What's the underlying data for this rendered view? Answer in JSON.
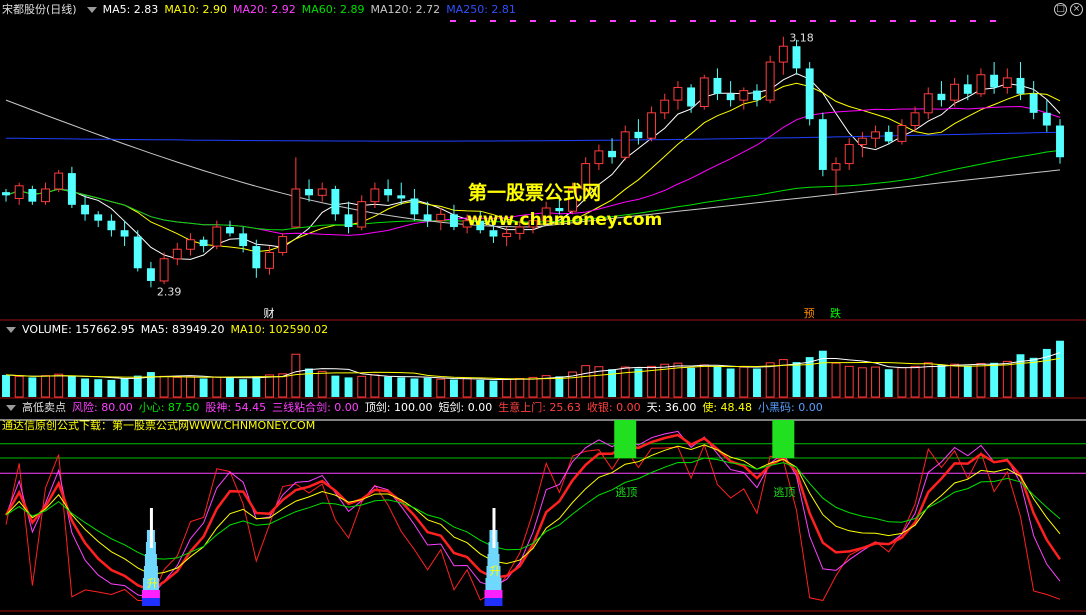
{
  "colors": {
    "up": "#ff3c3c",
    "down": "#54ffff",
    "bg": "#000000",
    "ma5": "#ffffff",
    "ma10": "#ffff00",
    "ma20": "#ff00ff",
    "ma60": "#00e000",
    "ma120": "#c8c8c8",
    "ma250": "#2040ff"
  },
  "header": {
    "title": "宋都股份(日线)",
    "ma": [
      {
        "label": "MA5: 2.83",
        "color": "#ffffff"
      },
      {
        "label": "MA10: 2.90",
        "color": "#ffff00"
      },
      {
        "label": "MA20: 2.92",
        "color": "#ff40ff"
      },
      {
        "label": "MA60: 2.89",
        "color": "#00e000"
      },
      {
        "label": "MA120: 2.72",
        "color": "#c8c8c8"
      },
      {
        "label": "MA250: 2.81",
        "color": "#3050ff"
      }
    ]
  },
  "watermark": {
    "line1": "第一股票公式网",
    "line2": "www.chnmoney.com"
  },
  "price_panel": {
    "high_label": "3.18",
    "low_label": "2.39",
    "markers": [
      {
        "text": "财",
        "color": "#ffffff",
        "idx": 20
      },
      {
        "text": "预",
        "color": "#ff8c00",
        "idx": 61
      },
      {
        "text": "跌",
        "color": "#00ff00",
        "idx": 63
      }
    ]
  },
  "volume_panel": {
    "items": [
      {
        "label": "VOLUME: 157662.95",
        "color": "#ffffff"
      },
      {
        "label": "MA5: 83949.20",
        "color": "#ffffff"
      },
      {
        "label": "MA10: 102590.02",
        "color": "#ffff00"
      }
    ]
  },
  "indicator_panel": {
    "name": "高低卖点",
    "items": [
      {
        "label": "风险: 80.00",
        "color": "#ff40ff"
      },
      {
        "label": "小心: 87.50",
        "color": "#00e000"
      },
      {
        "label": "股神: 54.45",
        "color": "#ff40ff"
      },
      {
        "label": "三线粘合剑: 0.00",
        "color": "#ff40ff"
      },
      {
        "label": "顶剑: 100.00",
        "color": "#ffffff"
      },
      {
        "label": "短剑: 0.00",
        "color": "#ffffff"
      },
      {
        "label": "生意上门: 25.63",
        "color": "#ff4040"
      },
      {
        "label": "收银: 0.00",
        "color": "#ff4040"
      },
      {
        "label": "天: 36.00",
        "color": "#ffffff"
      },
      {
        "label": "使: 48.48",
        "color": "#ffff00"
      },
      {
        "label": "小黑码: 0.00",
        "color": "#54a0ff"
      }
    ],
    "subtitle": "通达信原创公式下载：第一股票公式网WWW.CHNMONEY.COM",
    "escape_label": "逃顶",
    "rise_label": "升"
  },
  "chart_data": {
    "type": "candlestick",
    "title": "宋都股份(日线)",
    "ohlc": [
      [
        2.69,
        2.7,
        2.66,
        2.68
      ],
      [
        2.67,
        2.72,
        2.65,
        2.71
      ],
      [
        2.7,
        2.71,
        2.65,
        2.66
      ],
      [
        2.66,
        2.72,
        2.65,
        2.7
      ],
      [
        2.7,
        2.76,
        2.69,
        2.75
      ],
      [
        2.75,
        2.77,
        2.64,
        2.65
      ],
      [
        2.65,
        2.68,
        2.6,
        2.62
      ],
      [
        2.62,
        2.63,
        2.58,
        2.6
      ],
      [
        2.6,
        2.62,
        2.55,
        2.57
      ],
      [
        2.57,
        2.6,
        2.52,
        2.55
      ],
      [
        2.55,
        2.57,
        2.44,
        2.45
      ],
      [
        2.45,
        2.47,
        2.39,
        2.41
      ],
      [
        2.41,
        2.5,
        2.4,
        2.48
      ],
      [
        2.48,
        2.53,
        2.46,
        2.51
      ],
      [
        2.51,
        2.56,
        2.49,
        2.54
      ],
      [
        2.54,
        2.55,
        2.5,
        2.52
      ],
      [
        2.52,
        2.6,
        2.51,
        2.58
      ],
      [
        2.58,
        2.6,
        2.55,
        2.56
      ],
      [
        2.56,
        2.58,
        2.5,
        2.52
      ],
      [
        2.52,
        2.54,
        2.42,
        2.45
      ],
      [
        2.45,
        2.52,
        2.43,
        2.5
      ],
      [
        2.5,
        2.56,
        2.49,
        2.55
      ],
      [
        2.58,
        2.8,
        2.58,
        2.7
      ],
      [
        2.7,
        2.73,
        2.66,
        2.68
      ],
      [
        2.68,
        2.72,
        2.66,
        2.7
      ],
      [
        2.7,
        2.71,
        2.6,
        2.62
      ],
      [
        2.62,
        2.66,
        2.56,
        2.58
      ],
      [
        2.58,
        2.68,
        2.57,
        2.66
      ],
      [
        2.66,
        2.72,
        2.64,
        2.7
      ],
      [
        2.7,
        2.73,
        2.66,
        2.68
      ],
      [
        2.68,
        2.72,
        2.65,
        2.67
      ],
      [
        2.67,
        2.7,
        2.6,
        2.62
      ],
      [
        2.62,
        2.66,
        2.58,
        2.6
      ],
      [
        2.6,
        2.64,
        2.57,
        2.62
      ],
      [
        2.62,
        2.65,
        2.57,
        2.58
      ],
      [
        2.58,
        2.62,
        2.56,
        2.6
      ],
      [
        2.6,
        2.63,
        2.56,
        2.57
      ],
      [
        2.57,
        2.6,
        2.53,
        2.55
      ],
      [
        2.55,
        2.58,
        2.52,
        2.56
      ],
      [
        2.56,
        2.6,
        2.54,
        2.58
      ],
      [
        2.58,
        2.62,
        2.56,
        2.6
      ],
      [
        2.6,
        2.66,
        2.59,
        2.64
      ],
      [
        2.64,
        2.68,
        2.62,
        2.63
      ],
      [
        2.63,
        2.72,
        2.62,
        2.7
      ],
      [
        2.7,
        2.8,
        2.69,
        2.78
      ],
      [
        2.78,
        2.84,
        2.76,
        2.82
      ],
      [
        2.82,
        2.86,
        2.78,
        2.8
      ],
      [
        2.8,
        2.9,
        2.79,
        2.88
      ],
      [
        2.88,
        2.92,
        2.84,
        2.86
      ],
      [
        2.86,
        2.96,
        2.85,
        2.94
      ],
      [
        2.94,
        3.0,
        2.92,
        2.98
      ],
      [
        2.98,
        3.04,
        2.95,
        3.02
      ],
      [
        3.02,
        3.03,
        2.94,
        2.96
      ],
      [
        2.96,
        3.06,
        2.95,
        3.05
      ],
      [
        3.05,
        3.08,
        2.98,
        3.0
      ],
      [
        3.0,
        3.04,
        2.96,
        2.98
      ],
      [
        2.98,
        3.02,
        2.95,
        3.01
      ],
      [
        3.01,
        3.03,
        2.96,
        2.98
      ],
      [
        2.98,
        3.12,
        2.97,
        3.1
      ],
      [
        3.1,
        3.18,
        3.06,
        3.15
      ],
      [
        3.15,
        3.17,
        3.06,
        3.08
      ],
      [
        3.08,
        3.1,
        2.9,
        2.92
      ],
      [
        2.92,
        2.94,
        2.74,
        2.76
      ],
      [
        2.76,
        2.8,
        2.68,
        2.78
      ],
      [
        2.78,
        2.86,
        2.76,
        2.84
      ],
      [
        2.84,
        2.88,
        2.8,
        2.86
      ],
      [
        2.86,
        2.9,
        2.83,
        2.88
      ],
      [
        2.88,
        2.9,
        2.84,
        2.85
      ],
      [
        2.85,
        2.92,
        2.84,
        2.9
      ],
      [
        2.9,
        2.96,
        2.88,
        2.94
      ],
      [
        2.94,
        3.02,
        2.92,
        3.0
      ],
      [
        3.0,
        3.04,
        2.96,
        2.98
      ],
      [
        2.98,
        3.05,
        2.96,
        3.03
      ],
      [
        3.03,
        3.06,
        2.98,
        3.0
      ],
      [
        3.0,
        3.08,
        2.99,
        3.06
      ],
      [
        3.06,
        3.1,
        3.0,
        3.02
      ],
      [
        3.02,
        3.08,
        3.0,
        3.05
      ],
      [
        3.05,
        3.1,
        2.98,
        3.0
      ],
      [
        3.0,
        3.04,
        2.92,
        2.94
      ],
      [
        2.94,
        2.98,
        2.88,
        2.9
      ],
      [
        2.9,
        2.92,
        2.78,
        2.8
      ]
    ],
    "volume": [
      62,
      58,
      55,
      60,
      64,
      58,
      52,
      50,
      48,
      52,
      60,
      70,
      58,
      55,
      57,
      52,
      56,
      54,
      50,
      58,
      62,
      65,
      120,
      80,
      72,
      60,
      55,
      58,
      62,
      57,
      55,
      52,
      54,
      50,
      49,
      52,
      48,
      46,
      50,
      52,
      55,
      60,
      58,
      70,
      88,
      85,
      78,
      84,
      80,
      86,
      92,
      95,
      82,
      90,
      86,
      80,
      84,
      80,
      96,
      105,
      98,
      112,
      130,
      95,
      86,
      82,
      84,
      78,
      82,
      86,
      96,
      90,
      92,
      88,
      94,
      96,
      100,
      120,
      110,
      135,
      158
    ],
    "volume_ma5": 83949.2,
    "volume_ma10": 102590.02,
    "high": 3.18,
    "low": 2.39
  }
}
